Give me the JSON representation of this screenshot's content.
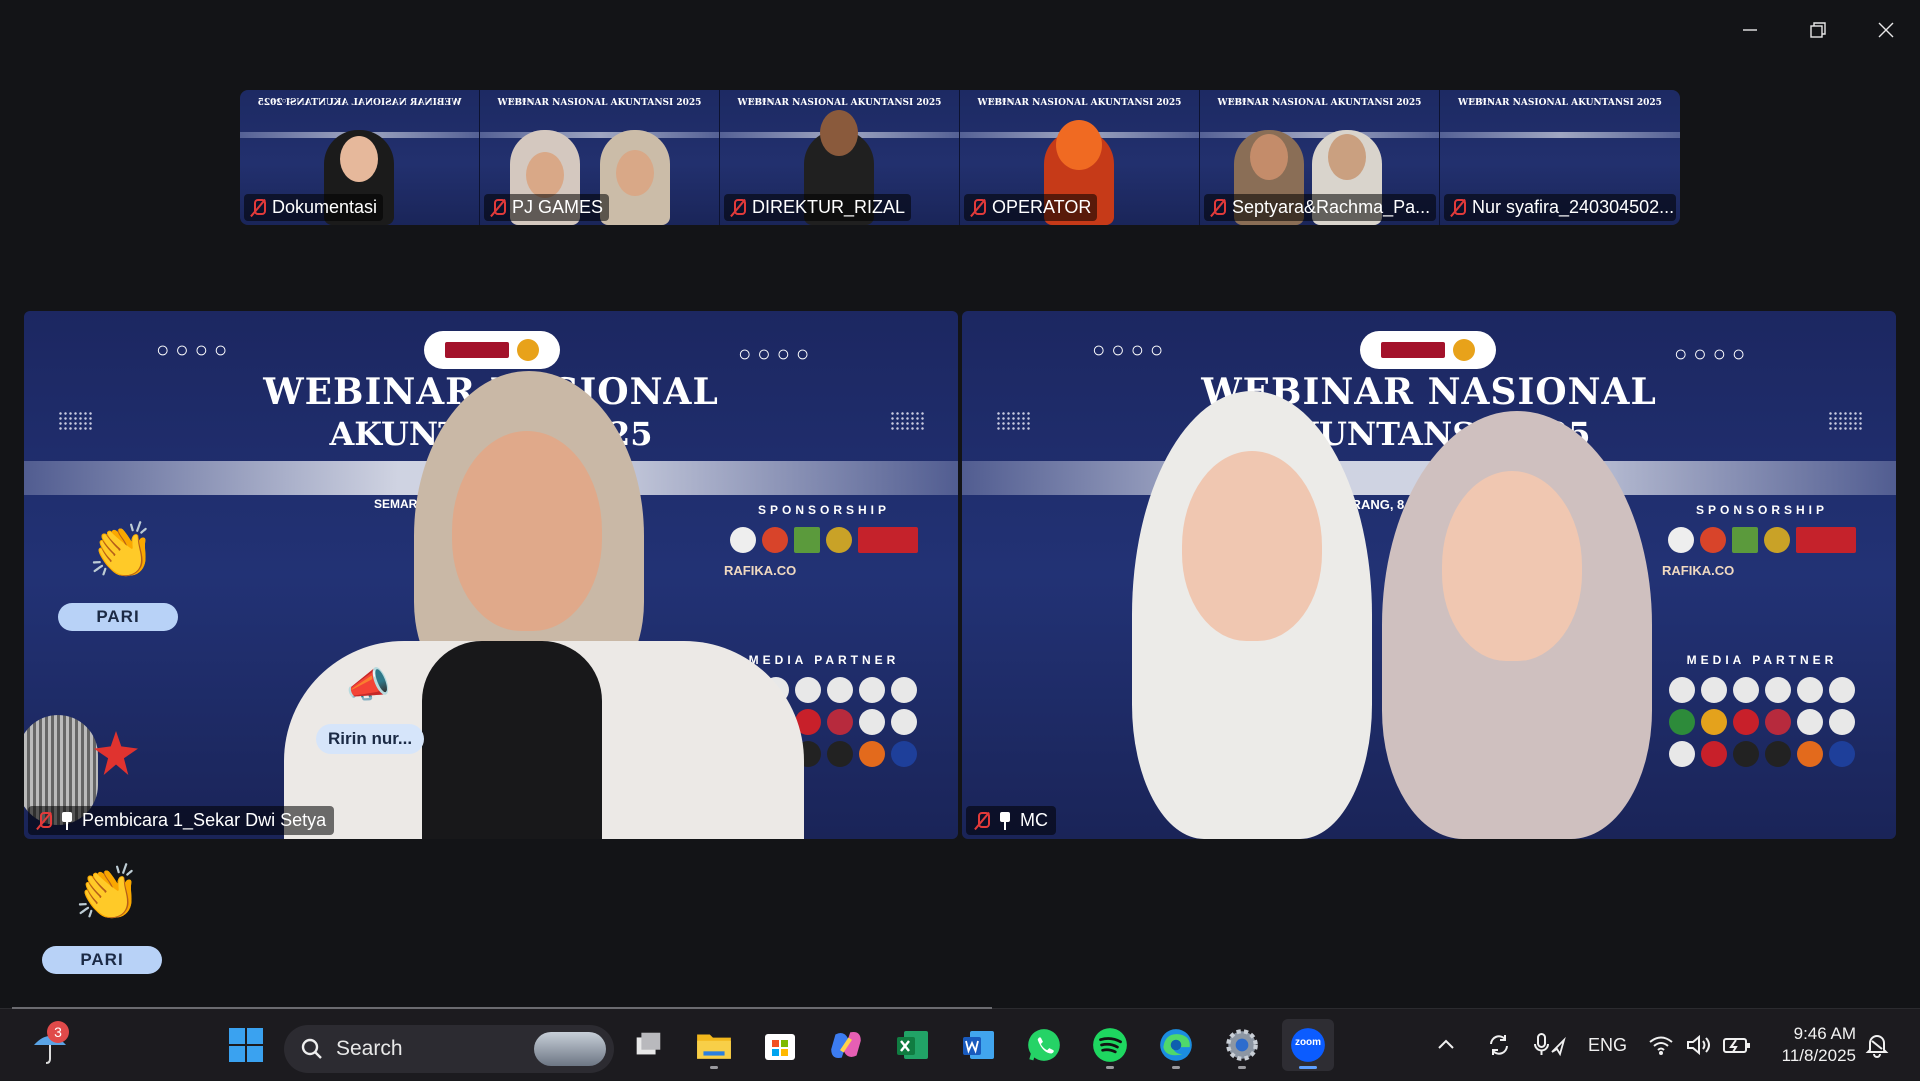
{
  "window": {
    "controls": {
      "minimize": "minimize-icon",
      "restore": "restore-icon",
      "close": "close-icon"
    }
  },
  "thumbnails": [
    {
      "name": "Dokumentasi",
      "banner": "WEBINAR NASIONAL AKUNTANSI 2025",
      "mirrored": true
    },
    {
      "name": "PJ GAMES",
      "banner": "WEBINAR NASIONAL AKUNTANSI 2025"
    },
    {
      "name": "DIREKTUR_RIZAL",
      "banner": "WEBINAR NASIONAL AKUNTANSI 2025"
    },
    {
      "name": "OPERATOR",
      "banner": "WEBINAR NASIONAL AKUNTANSI 2025"
    },
    {
      "name": "Septyara&Rachma_Pa...",
      "banner": "WEBINAR NASIONAL AKUNTANSI 2025"
    },
    {
      "name": "Nur syafira_240304502...",
      "banner": "WEBINAR NASIONAL AKUNTANSI 2025"
    }
  ],
  "speakers": [
    {
      "name": "Pembicara 1_Sekar Dwi Setya",
      "title1": "WEBINAR NASIONAL",
      "title2": "AKUNTANSI 2025",
      "sponsorship": "SPONSORSHIP",
      "sponsor_text": "RAFIKA.CO",
      "media_partner": "MEDIA PARTNER",
      "location": "SEMARANG, 8 NOVEMBER"
    },
    {
      "name": "MC",
      "title1": "WEBINAR NASIONAL",
      "title2": "AKUNTANSI 2025",
      "sponsorship": "SPONSORSHIP",
      "sponsor_text": "RAFIKA.CO",
      "media_partner": "MEDIA PARTNER",
      "location": "SEMARANG, 8 NOVEMBER"
    }
  ],
  "reactions": [
    {
      "emoji": "👏",
      "label": "PARI"
    },
    {
      "emoji": "👏",
      "label": "PARI"
    }
  ],
  "chat_bubble": {
    "emoji": "📣",
    "text": "Ririn nur..."
  },
  "taskbar": {
    "weather_badge": "3",
    "search_placeholder": "Search",
    "apps": [
      "start-icon",
      "task-view-icon",
      "file-explorer-icon",
      "microsoft-store-icon",
      "copilot-icon",
      "excel-icon",
      "word-icon",
      "whatsapp-icon",
      "spotify-icon",
      "edge-icon",
      "settings-icon",
      "zoom-icon"
    ],
    "zoom_label": "zoom",
    "language": "ENG",
    "time": "9:46 AM",
    "date": "11/8/2025"
  },
  "colors": {
    "accent": "#5ea0ff",
    "pill": "#b8d2f7",
    "banner": "#1d2a63",
    "mute": "#e23a3a"
  }
}
